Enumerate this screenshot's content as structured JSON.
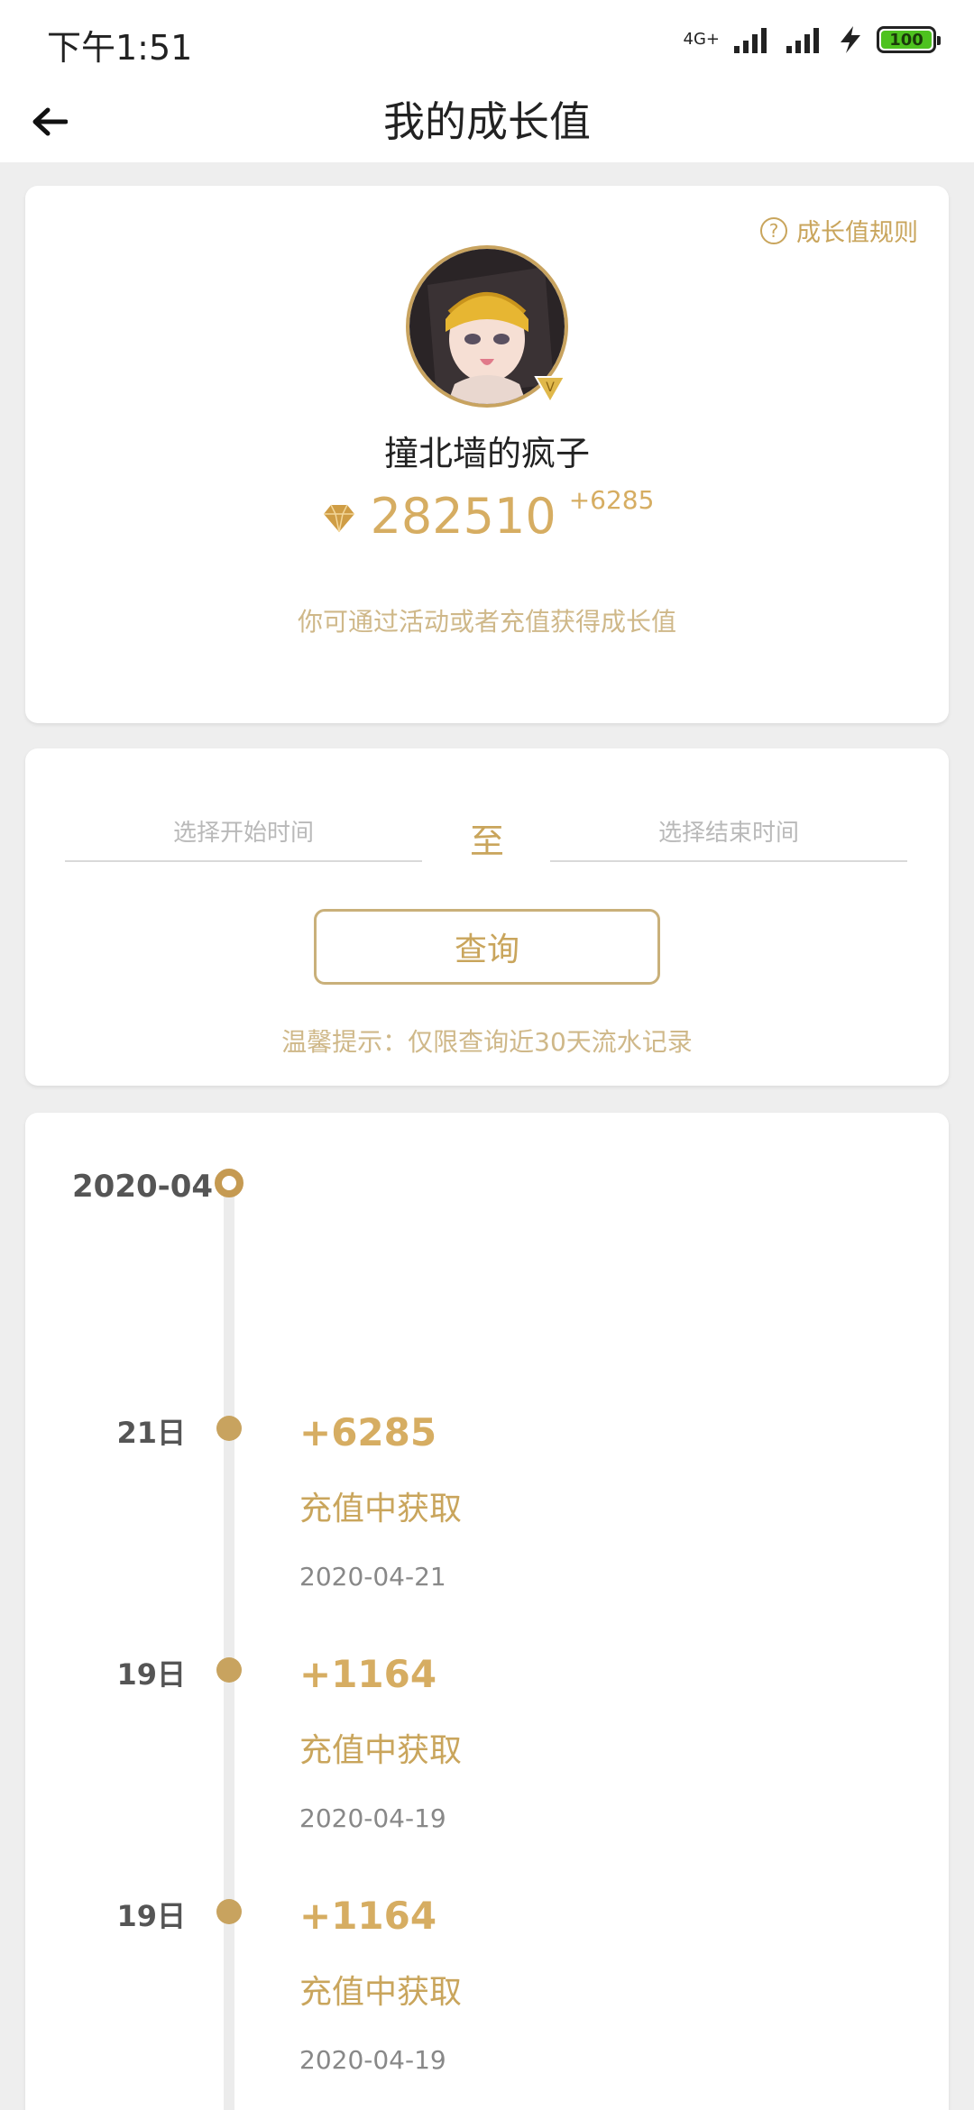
{
  "status_bar": {
    "time": "下午1:51",
    "network": "4G+",
    "battery": "100"
  },
  "header": {
    "title": "我的成长值"
  },
  "profile": {
    "rules_link": "成长值规则",
    "username": "撞北墙的疯子",
    "growth_value": "282510",
    "growth_delta": "+6285",
    "hint": "你可通过活动或者充值获得成长值"
  },
  "query": {
    "start_placeholder": "选择开始时间",
    "to_label": "至",
    "end_placeholder": "选择结束时间",
    "button_label": "查询",
    "tip": "温馨提示：仅限查询近30天流水记录"
  },
  "records": {
    "month": "2020-04",
    "entries": [
      {
        "day": "21日",
        "amount": "+6285",
        "source": "充值中获取",
        "date": "2020-04-21"
      },
      {
        "day": "19日",
        "amount": "+1164",
        "source": "充值中获取",
        "date": "2020-04-19"
      },
      {
        "day": "19日",
        "amount": "+1164",
        "source": "充值中获取",
        "date": "2020-04-19"
      }
    ]
  },
  "colors": {
    "accent_gold": "#d6ad62",
    "light_gold_text": "#cfb889",
    "battery_green": "#4ec21f"
  }
}
